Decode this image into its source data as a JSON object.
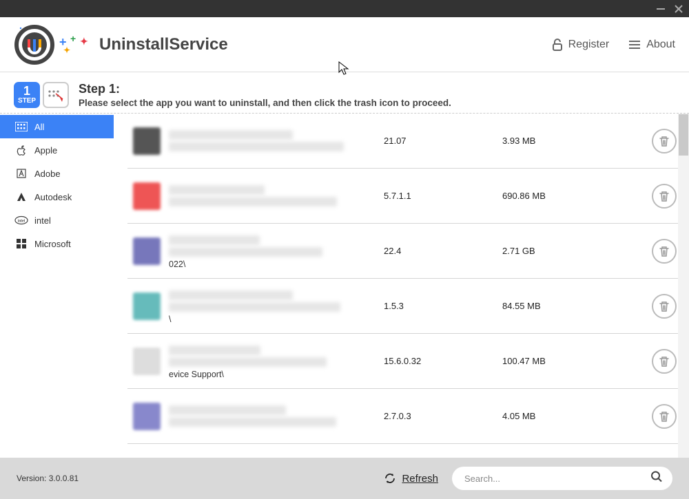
{
  "window": {
    "minimize_icon": "minimize",
    "close_icon": "close"
  },
  "header": {
    "logo_text": "UninstallService",
    "register_label": "Register",
    "about_label": "About"
  },
  "step": {
    "title": "Step 1:",
    "subtitle": "Please select the app you want to uninstall, and then click the trash icon to proceed.",
    "badge1_num": "1",
    "badge1_label": "STEP"
  },
  "sidebar": {
    "items": [
      {
        "label": "All",
        "icon": "grid",
        "active": true
      },
      {
        "label": "Apple",
        "icon": "apple",
        "active": false
      },
      {
        "label": "Adobe",
        "icon": "adobe",
        "active": false
      },
      {
        "label": "Autodesk",
        "icon": "autodesk",
        "active": false
      },
      {
        "label": "intel",
        "icon": "intel",
        "active": false
      },
      {
        "label": "Microsoft",
        "icon": "microsoft",
        "active": false
      }
    ]
  },
  "apps": [
    {
      "version": "21.07",
      "size": "3.93 MB",
      "path_fragment": ""
    },
    {
      "version": "5.7.1.1",
      "size": "690.86 MB",
      "path_fragment": ""
    },
    {
      "version": "22.4",
      "size": "2.71 GB",
      "path_fragment": "022\\"
    },
    {
      "version": "1.5.3",
      "size": "84.55 MB",
      "path_fragment": "\\"
    },
    {
      "version": "15.6.0.32",
      "size": "100.47 MB",
      "path_fragment": "evice Support\\"
    },
    {
      "version": "2.7.0.3",
      "size": "4.05 MB",
      "path_fragment": ""
    }
  ],
  "footer": {
    "version_text": "Version: 3.0.0.81",
    "refresh_label": "Refresh",
    "search_placeholder": "Search..."
  },
  "colors": {
    "accent": "#3b82f6",
    "titlebar": "#333333",
    "footer": "#d9d9d9"
  }
}
